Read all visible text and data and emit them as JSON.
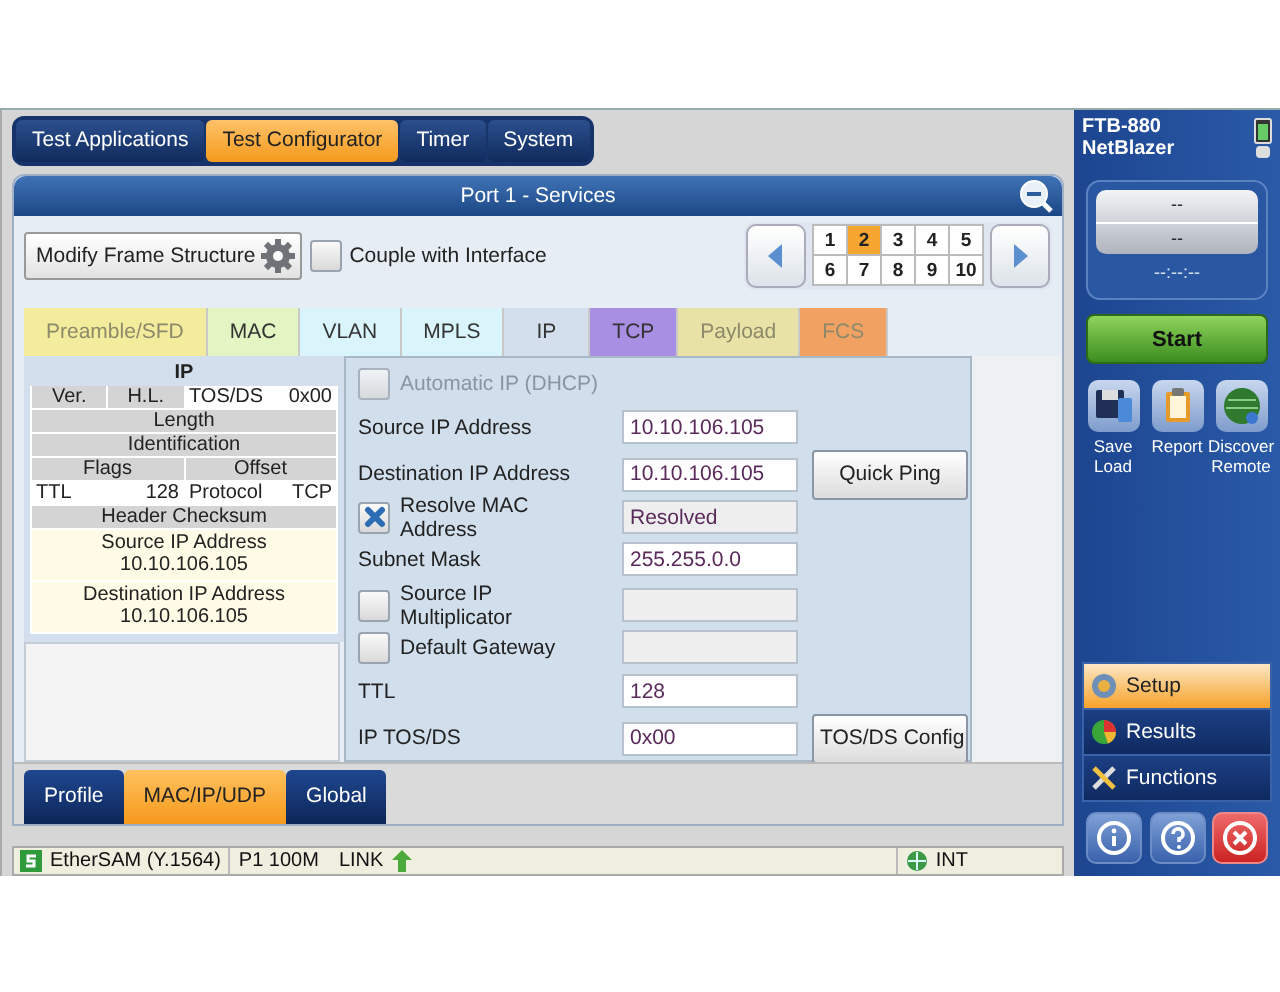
{
  "top_tabs": [
    {
      "label": "Test Applications",
      "selected": false
    },
    {
      "label": "Test Configurator",
      "selected": true
    },
    {
      "label": "Timer",
      "selected": false
    },
    {
      "label": "System",
      "selected": false
    }
  ],
  "panel": {
    "title": "Port 1 - Services"
  },
  "toolbar": {
    "modify_button": "Modify Frame Structure",
    "couple": {
      "label": "Couple with Interface",
      "checked": false
    },
    "pages": [
      {
        "label": "1",
        "selected": false
      },
      {
        "label": "2",
        "selected": true
      },
      {
        "label": "3",
        "selected": false
      },
      {
        "label": "4",
        "selected": false
      },
      {
        "label": "5",
        "selected": false
      },
      {
        "label": "6",
        "selected": false
      },
      {
        "label": "7",
        "selected": false
      },
      {
        "label": "8",
        "selected": false
      },
      {
        "label": "9",
        "selected": false
      },
      {
        "label": "10",
        "selected": false
      }
    ]
  },
  "layer_tabs": [
    {
      "label": "Preamble/SFD",
      "color": "#f2ec9c",
      "selected": false,
      "disabled": true
    },
    {
      "label": "MAC",
      "color": "#e2f5c2",
      "selected": false,
      "disabled": false
    },
    {
      "label": "VLAN",
      "color": "#d9f5fb",
      "selected": false,
      "disabled": false
    },
    {
      "label": "MPLS",
      "color": "#d9f5fb",
      "selected": false,
      "disabled": false
    },
    {
      "label": "IP",
      "color": "#d3dfec",
      "selected": true,
      "disabled": false
    },
    {
      "label": "TCP",
      "color": "#a88fe4",
      "selected": false,
      "disabled": false
    },
    {
      "label": "Payload",
      "color": "#e8e2a6",
      "selected": false,
      "disabled": true
    },
    {
      "label": "FCS",
      "color": "#f1a263",
      "selected": false,
      "disabled": true
    }
  ],
  "header_diagram": {
    "title": "IP",
    "lines": [
      {
        "fields": [
          {
            "kind": "inline",
            "label": "Ver.",
            "highlighted": false
          },
          {
            "kind": "inline",
            "label": "H.L.",
            "highlighted": false
          },
          {
            "kind": "inline",
            "label": "TOS/DS",
            "value": "0x00",
            "highlighted": true
          }
        ]
      },
      {
        "fields": [
          {
            "kind": "inline",
            "label": "Length",
            "highlighted": false
          }
        ]
      },
      {
        "fields": [
          {
            "kind": "inline",
            "label": "Identification",
            "highlighted": false
          }
        ]
      },
      {
        "fields": [
          {
            "kind": "inline",
            "label": "Flags",
            "highlighted": false
          },
          {
            "kind": "inline",
            "label": "Offset",
            "highlighted": false
          }
        ]
      },
      {
        "fields": [
          {
            "kind": "inline",
            "label": "TTL",
            "value": "128",
            "highlighted": true
          },
          {
            "kind": "inline",
            "label": "Protocol",
            "value": "TCP",
            "highlighted": true
          }
        ]
      },
      {
        "fields": [
          {
            "kind": "inline",
            "label": "Header Checksum",
            "highlighted": false
          }
        ]
      },
      {
        "fields": [
          {
            "kind": "stacked",
            "label": "Source IP Address",
            "value": "10.10.106.105",
            "highlighted": true
          }
        ]
      },
      {
        "fields": [
          {
            "kind": "stacked",
            "label": "Destination IP Address",
            "value": "10.10.106.105",
            "highlighted": true
          }
        ]
      }
    ]
  },
  "form": [
    {
      "kind": "checkbox",
      "label": "Automatic IP (DHCP)",
      "checked": false,
      "disabled": true
    },
    {
      "kind": "field",
      "label": "Source IP Address",
      "value": "10.10.106.105",
      "disabled": false
    },
    {
      "kind": "field",
      "label": "Destination IP Address",
      "value": "10.10.106.105",
      "disabled": false,
      "button": "Quick Ping"
    },
    {
      "kind": "checkfield",
      "label": "Resolve MAC  Address",
      "checked": true,
      "value": "Resolved",
      "disabled": true
    },
    {
      "kind": "field",
      "label": "Subnet Mask",
      "value": "255.255.0.0",
      "disabled": false
    },
    {
      "kind": "checkfield",
      "label": "Source IP Multiplicator",
      "checked": false,
      "disabled": true
    },
    {
      "kind": "checkfield",
      "label": "Default Gateway",
      "checked": false,
      "disabled": true
    },
    {
      "kind": "field",
      "label": "TTL",
      "value": "128",
      "disabled": false
    },
    {
      "kind": "field",
      "label": "IP TOS/DS",
      "value": "0x00",
      "disabled": false,
      "button": "TOS/DS Config"
    }
  ],
  "bottom_tabs": [
    {
      "label": "Profile",
      "selected": false
    },
    {
      "label": "MAC/IP/UDP",
      "selected": true
    },
    {
      "label": "Global",
      "selected": false
    }
  ],
  "status_bar": {
    "test": "EtherSAM (Y.1564)",
    "port": "P1 100M",
    "link": "LINK",
    "clock": "INT"
  },
  "side_panel": {
    "model": "FTB-880",
    "product": "NetBlazer",
    "display": [
      "--",
      "--"
    ],
    "timer": "--:--:--",
    "start": "Start",
    "actions": [
      {
        "kind": "save",
        "label": "Save\nLoad"
      },
      {
        "kind": "report",
        "label": "Report"
      },
      {
        "kind": "discover",
        "label": "Discover\nRemote"
      }
    ],
    "nav": [
      {
        "kind": "setup",
        "label": "Setup",
        "selected": true
      },
      {
        "kind": "results",
        "label": "Results",
        "selected": false
      },
      {
        "kind": "functions",
        "label": "Functions",
        "selected": false
      }
    ]
  }
}
